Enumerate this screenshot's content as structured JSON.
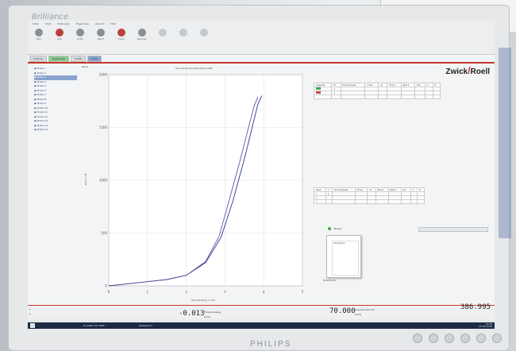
{
  "app": {
    "bezel_brand": "Brilliance",
    "monitor_brand": "PHILIPS"
  },
  "ribbon": {
    "tabs": [
      "Datei",
      "Start",
      "Prüfungen",
      "Ergebnisse",
      "Ansicht",
      "Hilfe"
    ],
    "tools": [
      {
        "label": "Start",
        "icon": "gear-icon"
      },
      {
        "label": "Stop",
        "icon": "stop-icon"
      },
      {
        "label": "Prüfen",
        "icon": "test-icon"
      },
      {
        "label": "Report",
        "icon": "report-icon"
      },
      {
        "label": "Export",
        "icon": "export-icon"
      },
      {
        "label": "Bewerten",
        "icon": "evaluate-icon"
      }
    ],
    "faint_tools": [
      "",
      "",
      ""
    ],
    "subtabs": [
      "Prüfung",
      "Ergebnisse",
      "Grafik",
      "Serie"
    ]
  },
  "logo": {
    "left": "Zwick",
    "right": "Roell"
  },
  "tree": {
    "items": [
      "Probe 1",
      "Probe 2",
      "Probe 3",
      "Probe 4",
      "Probe 5",
      "Probe 6",
      "Probe 7",
      "Probe 8",
      "Probe 9",
      "Probe 10",
      "Probe 11",
      "Probe 12",
      "Probe 13",
      "Probe 14",
      "Probe 15"
    ],
    "selected_index": 2
  },
  "chart": {
    "tab": "Serie",
    "title": "Standardkraft-Kraft-Weg Grafik",
    "ylabel": "Kraft in N",
    "xlabel": "Standardweg in mm"
  },
  "chart_data": {
    "type": "line",
    "x_ticks": [
      "0",
      "1",
      "2",
      "3",
      "4",
      "5"
    ],
    "y_ticks": [
      "0",
      "500",
      "1000",
      "1500",
      "2000"
    ],
    "xlim": [
      0,
      5
    ],
    "ylim": [
      0,
      2000
    ],
    "grid": true,
    "series": [
      {
        "color": "#1f3b8f",
        "x": [
          0,
          0.5,
          1,
          1.5,
          2,
          2.5,
          2.9,
          3.2,
          3.5,
          3.7,
          3.85,
          3.95
        ],
        "y": [
          0,
          20,
          40,
          60,
          100,
          220,
          460,
          800,
          1200,
          1500,
          1720,
          1800
        ]
      },
      {
        "color": "#6a4fa3",
        "x": [
          0,
          0.5,
          1,
          1.5,
          2,
          2.5,
          2.85,
          3.1,
          3.4,
          3.6,
          3.75,
          3.85
        ],
        "y": [
          0,
          20,
          40,
          60,
          100,
          230,
          470,
          800,
          1200,
          1490,
          1700,
          1790
        ]
      }
    ]
  },
  "results_table": {
    "header": [
      "Legende",
      "Nr",
      "Durchmesser",
      "Fmax",
      "dL",
      "Emod",
      "Rp0.2",
      "Rm",
      "A",
      "Z"
    ],
    "rows": [
      [
        "",
        "1",
        "",
        "",
        "",
        "",
        "",
        "",
        "",
        ""
      ],
      [
        "",
        "2",
        "",
        "",
        "",
        "",
        "",
        "",
        "",
        ""
      ],
      [
        "",
        "",
        "",
        "",
        "",
        "",
        "",
        "",
        "",
        ""
      ]
    ],
    "swatches": [
      "#3fae49",
      "#d04a3a"
    ]
  },
  "stats_table": {
    "header": [
      "Serie",
      "n",
      "Durchmesser",
      "Fmax",
      "dL",
      "Emod",
      "Rp0.2",
      "Rm",
      "A",
      "Z"
    ],
    "rows": [
      [
        "x",
        "2",
        "",
        "",
        "",
        "",
        "",
        "",
        "",
        ""
      ],
      [
        "s",
        "",
        "",
        "",
        "",
        "",
        "",
        "",
        "",
        ""
      ],
      [
        "v",
        "",
        "",
        "",
        "",
        "",
        "",
        "",
        "",
        ""
      ]
    ]
  },
  "status": {
    "label": "Bereit",
    "caption": "Prüfprotokoll"
  },
  "readouts": {
    "left_stack": [
      "F",
      "s"
    ],
    "value1": "-0.013",
    "label1": "Traversenweg",
    "unit1": "[mm]",
    "value2": "70.000",
    "label2": "Traverse absolut",
    "unit2": "[mm]",
    "value3": "386.995"
  },
  "taskbar": {
    "items": [
      "IX_Daten für DSM",
      "testXpert II"
    ],
    "tray_time": "12:45",
    "tray_date": "15.03.2018"
  }
}
